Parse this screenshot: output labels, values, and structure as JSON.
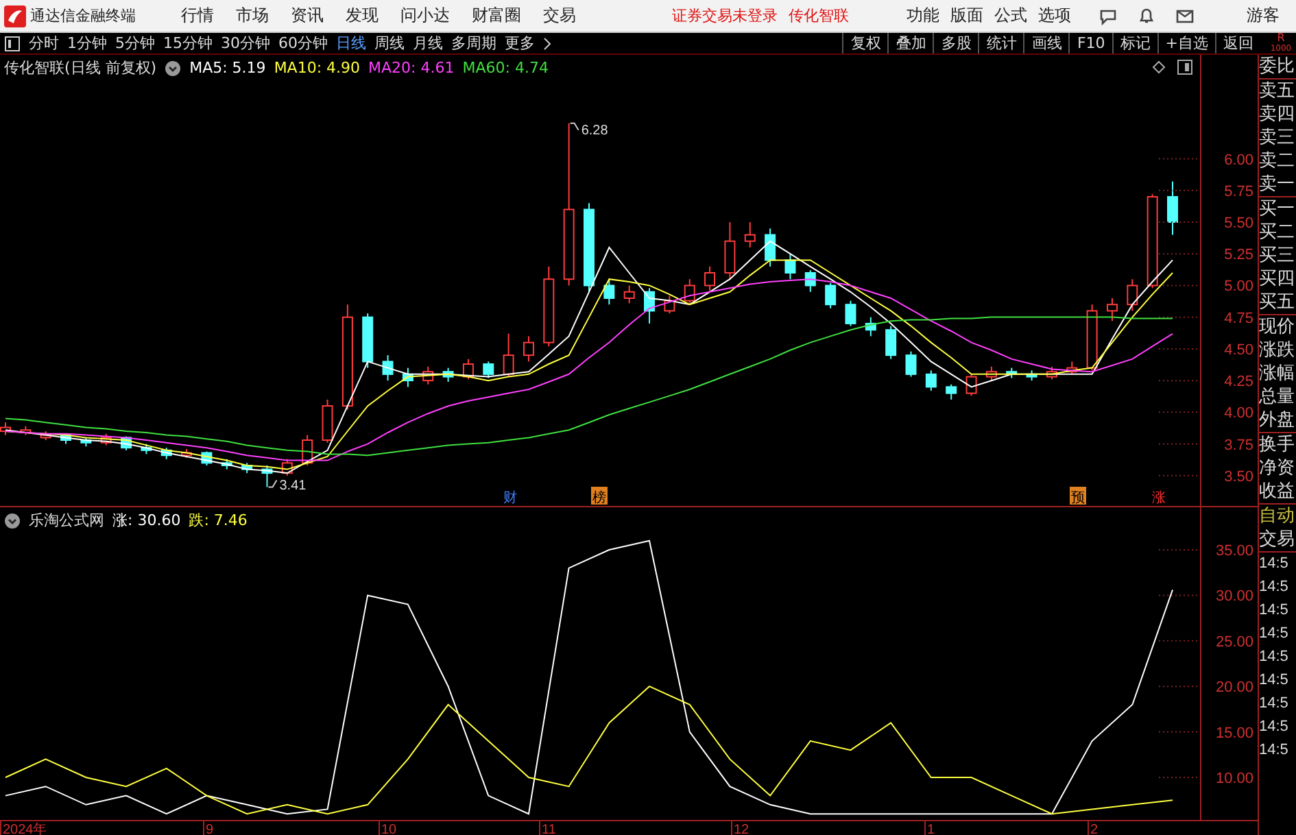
{
  "app": {
    "title": "通达信金融终端"
  },
  "menu": [
    "行情",
    "市场",
    "资讯",
    "发现",
    "问小达",
    "财富圈",
    "交易"
  ],
  "status": [
    "证券交易未登录",
    "传化智联"
  ],
  "top_actions": [
    "功能",
    "版面",
    "公式",
    "选项"
  ],
  "user": "游客",
  "periods": [
    {
      "label": "分时",
      "selected": false
    },
    {
      "label": "1分钟",
      "selected": false
    },
    {
      "label": "5分钟",
      "selected": false
    },
    {
      "label": "15分钟",
      "selected": false
    },
    {
      "label": "30分钟",
      "selected": false
    },
    {
      "label": "60分钟",
      "selected": false
    },
    {
      "label": "日线",
      "selected": true
    },
    {
      "label": "周线",
      "selected": false
    },
    {
      "label": "月线",
      "selected": false
    },
    {
      "label": "多周期",
      "selected": false
    },
    {
      "label": "更多",
      "selected": false
    }
  ],
  "tools": [
    "复权",
    "叠加",
    "多股",
    "统计",
    "画线",
    "F10",
    "标记",
    "+自选",
    "返回"
  ],
  "corner": [
    "R",
    "1000"
  ],
  "main_pane": {
    "legend": {
      "title": "传化智联(日线 前复权)",
      "values": [
        ": 5.19",
        ": 4.90",
        ": 4.61",
        ": 4.74"
      ]
    },
    "chart_data": {
      "type": "candlestick",
      "ylim": [
        3.25,
        6.82
      ],
      "ohlc": [
        [
          3.85,
          3.92,
          3.82,
          3.88
        ],
        [
          3.84,
          3.89,
          3.82,
          3.86
        ],
        [
          3.8,
          3.85,
          3.78,
          3.82
        ],
        [
          3.82,
          3.83,
          3.75,
          3.78
        ],
        [
          3.78,
          3.8,
          3.73,
          3.76
        ],
        [
          3.76,
          3.83,
          3.74,
          3.8
        ],
        [
          3.8,
          3.81,
          3.7,
          3.72
        ],
        [
          3.72,
          3.75,
          3.67,
          3.7
        ],
        [
          3.7,
          3.72,
          3.63,
          3.66
        ],
        [
          3.66,
          3.71,
          3.64,
          3.68
        ],
        [
          3.68,
          3.69,
          3.58,
          3.6
        ],
        [
          3.6,
          3.63,
          3.55,
          3.58
        ],
        [
          3.58,
          3.6,
          3.52,
          3.55
        ],
        [
          3.55,
          3.58,
          3.41,
          3.52
        ],
        [
          3.52,
          3.63,
          3.5,
          3.6
        ],
        [
          3.6,
          3.82,
          3.58,
          3.78
        ],
        [
          3.78,
          4.1,
          3.76,
          4.05
        ],
        [
          4.05,
          4.85,
          4.02,
          4.75
        ],
        [
          4.75,
          4.78,
          4.35,
          4.4
        ],
        [
          4.4,
          4.45,
          4.25,
          4.3
        ],
        [
          4.3,
          4.35,
          4.2,
          4.25
        ],
        [
          4.25,
          4.36,
          4.22,
          4.32
        ],
        [
          4.32,
          4.35,
          4.24,
          4.28
        ],
        [
          4.28,
          4.42,
          4.26,
          4.38
        ],
        [
          4.38,
          4.4,
          4.27,
          4.3
        ],
        [
          4.3,
          4.62,
          4.28,
          4.45
        ],
        [
          4.45,
          4.6,
          4.4,
          4.55
        ],
        [
          4.55,
          5.15,
          4.52,
          5.05
        ],
        [
          5.05,
          6.28,
          5,
          5.6
        ],
        [
          5.6,
          5.65,
          4.95,
          5
        ],
        [
          5,
          5.05,
          4.85,
          4.9
        ],
        [
          4.9,
          5,
          4.86,
          4.95
        ],
        [
          4.95,
          4.98,
          4.7,
          4.8
        ],
        [
          4.8,
          4.92,
          4.78,
          4.88
        ],
        [
          4.88,
          5.05,
          4.85,
          5
        ],
        [
          5,
          5.15,
          4.96,
          5.1
        ],
        [
          5.1,
          5.5,
          5.05,
          5.35
        ],
        [
          5.35,
          5.5,
          5.3,
          5.4
        ],
        [
          5.4,
          5.45,
          5.15,
          5.2
        ],
        [
          5.2,
          5.25,
          5.05,
          5.1
        ],
        [
          5.1,
          5.12,
          4.95,
          5
        ],
        [
          5,
          5.02,
          4.82,
          4.85
        ],
        [
          4.85,
          4.88,
          4.68,
          4.7
        ],
        [
          4.7,
          4.75,
          4.6,
          4.65
        ],
        [
          4.65,
          4.68,
          4.42,
          4.45
        ],
        [
          4.45,
          4.48,
          4.28,
          4.3
        ],
        [
          4.3,
          4.33,
          4.17,
          4.2
        ],
        [
          4.2,
          4.22,
          4.1,
          4.15
        ],
        [
          4.15,
          4.3,
          4.13,
          4.28
        ],
        [
          4.28,
          4.36,
          4.25,
          4.32
        ],
        [
          4.32,
          4.35,
          4.27,
          4.3
        ],
        [
          4.3,
          4.33,
          4.25,
          4.28
        ],
        [
          4.28,
          4.36,
          4.26,
          4.32
        ],
        [
          4.32,
          4.4,
          4.3,
          4.35
        ],
        [
          4.35,
          4.85,
          4.33,
          4.8
        ],
        [
          4.8,
          4.9,
          4.72,
          4.85
        ],
        [
          4.85,
          5.05,
          4.8,
          5
        ],
        [
          5,
          5.72,
          4.98,
          5.7
        ],
        [
          5.7,
          5.82,
          5.4,
          5.5
        ]
      ],
      "annotations": [
        "6.28",
        "3.41"
      ]
    },
    "event_markers": [
      {
        "label": "财",
        "kind": "plain",
        "color": "#4080ff"
      },
      {
        "label": "榜",
        "kind": "boxed",
        "color": "#e08020"
      },
      {
        "label": "预",
        "kind": "boxed",
        "color": "#e08020"
      },
      {
        "label": "涨",
        "kind": "plain",
        "color": "#ff3030"
      }
    ],
    "moving_averages": {
      "chart_data": {
        "type": "line",
        "ylim": [
          3.25,
          6.82
        ],
        "yticks": [
          {
            "value": 3.5,
            "label": "3.50"
          },
          {
            "value": 3.75,
            "label": "3.75"
          },
          {
            "value": 4,
            "label": "4.00"
          },
          {
            "value": 4.25,
            "label": "4.25"
          },
          {
            "value": 4.5,
            "label": "4.50"
          },
          {
            "value": 4.75,
            "label": "4.75"
          },
          {
            "value": 5,
            "label": "5.00"
          },
          {
            "value": 5.25,
            "label": "5.25"
          },
          {
            "value": 5.5,
            "label": "5.50"
          },
          {
            "value": 5.75,
            "label": "5.75"
          },
          {
            "value": 6,
            "label": "6.00"
          }
        ],
        "series": [
          {
            "name": "MA5",
            "color": "#ffffff",
            "values": [
              3.86,
              3.84,
              3.82,
              3.8,
              3.78,
              3.77,
              3.75,
              3.72,
              3.68,
              3.65,
              3.62,
              3.59,
              3.55,
              3.54,
              3.52,
              3.61,
              3.7,
              4.05,
              4.4,
              4.35,
              4.3,
              4.3,
              4.3,
              4.29,
              4.28,
              4.3,
              4.32,
              4.46,
              4.6,
              4.95,
              5.3,
              5.1,
              4.9,
              4.88,
              4.85,
              4.95,
              5.05,
              5.2,
              5.35,
              5.25,
              5.15,
              5.05,
              4.95,
              4.83,
              4.7,
              4.55,
              4.4,
              4.3,
              4.2,
              4.25,
              4.3,
              4.3,
              4.3,
              4.3,
              4.3,
              4.58,
              4.85,
              5.03,
              5.2
            ]
          },
          {
            "name": "MA10",
            "color": "#ffff40",
            "values": [
              3.85,
              3.84,
              3.83,
              3.82,
              3.8,
              3.79,
              3.78,
              3.74,
              3.7,
              3.68,
              3.65,
              3.62,
              3.58,
              3.57,
              3.55,
              3.6,
              3.65,
              3.85,
              4.05,
              4.17,
              4.28,
              4.29,
              4.3,
              4.28,
              4.25,
              4.28,
              4.3,
              4.38,
              4.45,
              4.75,
              5.05,
              5.03,
              5,
              4.93,
              4.85,
              4.9,
              4.95,
              5.08,
              5.2,
              5.2,
              5.2,
              5.1,
              5,
              4.9,
              4.8,
              4.68,
              4.55,
              4.43,
              4.3,
              4.3,
              4.3,
              4.3,
              4.3,
              4.33,
              4.35,
              4.55,
              4.75,
              4.93,
              5.1
            ]
          },
          {
            "name": "MA20",
            "color": "#ff40ff",
            "values": [
              3.85,
              3.84,
              3.83,
              3.83,
              3.82,
              3.81,
              3.8,
              3.78,
              3.76,
              3.74,
              3.72,
              3.69,
              3.66,
              3.64,
              3.62,
              3.62,
              3.62,
              3.69,
              3.75,
              3.84,
              3.92,
              3.99,
              4.05,
              4.09,
              4.12,
              4.15,
              4.18,
              4.24,
              4.3,
              4.43,
              4.55,
              4.69,
              4.82,
              4.87,
              4.92,
              4.95,
              4.98,
              5.01,
              5.03,
              5.04,
              5.05,
              5.03,
              5,
              4.95,
              4.9,
              4.81,
              4.72,
              4.64,
              4.55,
              4.49,
              4.42,
              4.38,
              4.34,
              4.33,
              4.32,
              4.37,
              4.42,
              4.52,
              4.62
            ]
          },
          {
            "name": "MA60",
            "color": "#40e040",
            "values": [
              3.95,
              3.94,
              3.92,
              3.9,
              3.88,
              3.87,
              3.85,
              3.84,
              3.82,
              3.81,
              3.79,
              3.77,
              3.74,
              3.72,
              3.7,
              3.69,
              3.67,
              3.67,
              3.66,
              3.68,
              3.7,
              3.72,
              3.74,
              3.75,
              3.76,
              3.78,
              3.8,
              3.83,
              3.86,
              3.92,
              3.98,
              4.03,
              4.08,
              4.13,
              4.18,
              4.24,
              4.3,
              4.36,
              4.42,
              4.49,
              4.55,
              4.6,
              4.65,
              4.69,
              4.72,
              4.73,
              4.73,
              4.74,
              4.74,
              4.75,
              4.75,
              4.75,
              4.75,
              4.75,
              4.75,
              4.75,
              4.74,
              4.74,
              4.74
            ]
          }
        ]
      }
    }
  },
  "indicator_pane": {
    "legend": {
      "title": "乐淘公式网",
      "values": [
        ": 30.60",
        ": 7.46"
      ]
    },
    "chart_data": {
      "type": "line",
      "ylim": [
        5.33,
        39.67
      ],
      "yticks": [
        {
          "value": 10,
          "label": "10.00"
        },
        {
          "value": 15,
          "label": "15.00"
        },
        {
          "value": 20,
          "label": "20.00"
        },
        {
          "value": 25,
          "label": "25.00"
        },
        {
          "value": 30,
          "label": "30.00"
        },
        {
          "value": 35,
          "label": "35.00"
        }
      ],
      "series": [
        {
          "name": "涨",
          "color": "#ffffff",
          "values": [
            8,
            9,
            7,
            8,
            6,
            8,
            7,
            6,
            6.5,
            30,
            29,
            20,
            8,
            6,
            33,
            35,
            36,
            15,
            9,
            7,
            6,
            6,
            6,
            6,
            6,
            6,
            6,
            14,
            18,
            30.6
          ]
        },
        {
          "name": "跌",
          "color": "#ffff40",
          "values": [
            10,
            12,
            10,
            9,
            11,
            8,
            6,
            7,
            6,
            7,
            12,
            18,
            14,
            10,
            9,
            16,
            20,
            18,
            12,
            8,
            14,
            13,
            16,
            10,
            10,
            8,
            6,
            6.5,
            7,
            7.5
          ]
        }
      ]
    }
  },
  "x_axis_labels": [
    "2024年",
    "9",
    "10",
    "11",
    "12",
    "1",
    "2"
  ],
  "quote_panel": {
    "groups": [
      [
        "委比"
      ],
      [
        "卖五",
        "卖四",
        "卖三",
        "卖二",
        "卖一"
      ],
      [
        "买一",
        "买二",
        "买三",
        "买四",
        "买五"
      ],
      [
        "现价",
        "涨跌",
        "涨幅",
        "总量",
        "外盘"
      ],
      [
        "换手",
        "净资",
        "收益"
      ]
    ],
    "auto": "自动",
    "trade": "交易",
    "times": [
      "14:5",
      "14:5",
      "14:5",
      "14:5",
      "14:5",
      "14:5",
      "14:5",
      "14:5",
      "14:5"
    ]
  }
}
